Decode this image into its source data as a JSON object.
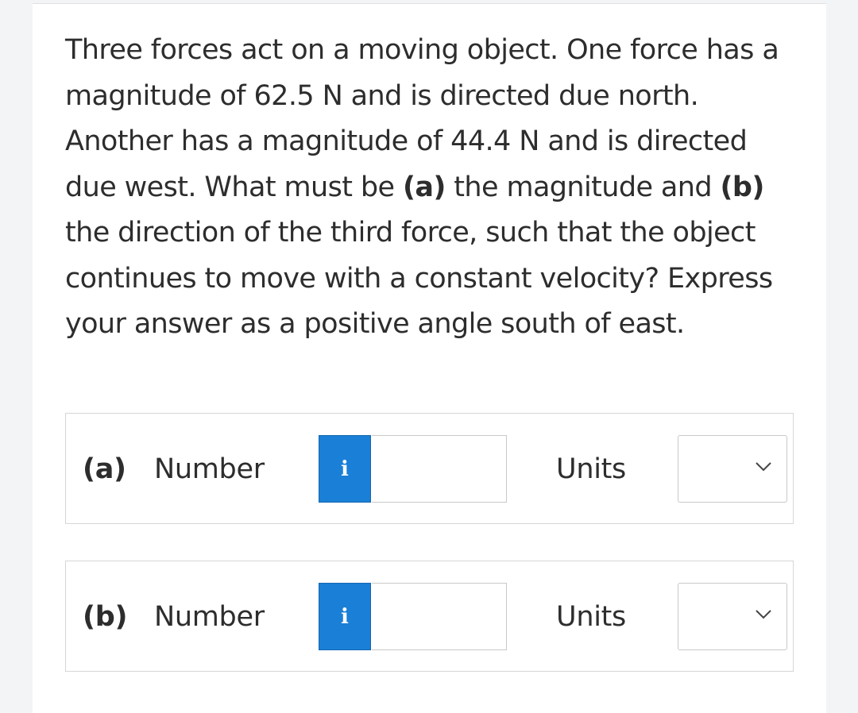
{
  "question": {
    "text_1": "Three forces act on a moving object. One force has a magnitude of 62.5 N and is directed due north. Another has a magnitude of 44.4 N and is directed due west. What must be ",
    "part_a_marker": "(a)",
    "text_2": " the magnitude and ",
    "part_b_marker": "(b)",
    "text_3": " the direction of the third force, such that the object continues to move with a constant velocity? Express your answer as a positive angle south of east."
  },
  "answers": [
    {
      "part_label": "(a)",
      "number_label": "Number",
      "info_icon": "info-icon",
      "info_glyph": "i",
      "value": "",
      "units_label": "Units",
      "units_selected": "",
      "dropdown_icon": "chevron-down-icon"
    },
    {
      "part_label": "(b)",
      "number_label": "Number",
      "info_icon": "info-icon",
      "info_glyph": "i",
      "value": "",
      "units_label": "Units",
      "units_selected": "",
      "dropdown_icon": "chevron-down-icon"
    }
  ],
  "colors": {
    "info_button": "#1a7fd6",
    "background": "#f3f4f5",
    "card": "#ffffff",
    "text": "#2d2d2d"
  }
}
